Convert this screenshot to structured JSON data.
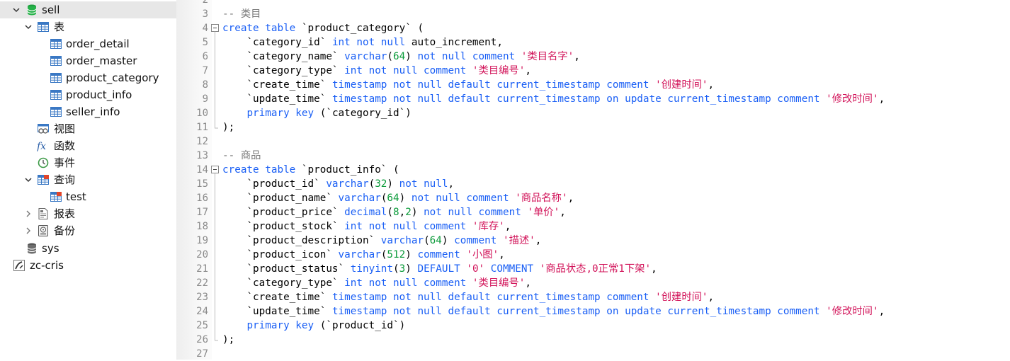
{
  "sidebar": {
    "db_sell": "sell",
    "tables_folder": "表",
    "tables": [
      "order_detail",
      "order_master",
      "product_category",
      "product_info",
      "seller_info"
    ],
    "views": "视图",
    "functions": "函数",
    "events": "事件",
    "queries": "查询",
    "query_items": [
      "test"
    ],
    "reports": "报表",
    "backups": "备份",
    "db_sys": "sys",
    "connection": "zc-cris"
  },
  "editor": {
    "lines": [
      {
        "n": "2",
        "tokens": []
      },
      {
        "n": "3",
        "tokens": [
          {
            "c": "cm",
            "t": "-- 类目"
          }
        ]
      },
      {
        "n": "4",
        "fold": "open",
        "tokens": [
          {
            "c": "kw",
            "t": "create table "
          },
          {
            "c": "",
            "t": "`product_category` ("
          }
        ]
      },
      {
        "n": "5",
        "tokens": [
          {
            "c": "",
            "t": "    `category_id` "
          },
          {
            "c": "kw",
            "t": "int not null "
          },
          {
            "c": "",
            "t": "auto_increment,"
          }
        ]
      },
      {
        "n": "6",
        "tokens": [
          {
            "c": "",
            "t": "    `category_name` "
          },
          {
            "c": "kw",
            "t": "varchar"
          },
          {
            "c": "",
            "t": "("
          },
          {
            "c": "num",
            "t": "64"
          },
          {
            "c": "",
            "t": ") "
          },
          {
            "c": "kw",
            "t": "not null comment "
          },
          {
            "c": "str",
            "t": "'类目名字'"
          },
          {
            "c": "",
            "t": ","
          }
        ]
      },
      {
        "n": "7",
        "tokens": [
          {
            "c": "",
            "t": "    `category_type` "
          },
          {
            "c": "kw",
            "t": "int not null comment "
          },
          {
            "c": "str",
            "t": "'类目编号'"
          },
          {
            "c": "",
            "t": ","
          }
        ]
      },
      {
        "n": "8",
        "tokens": [
          {
            "c": "",
            "t": "    `create_time` "
          },
          {
            "c": "kw",
            "t": "timestamp not null default current_timestamp comment "
          },
          {
            "c": "str",
            "t": "'创建时间'"
          },
          {
            "c": "",
            "t": ","
          }
        ]
      },
      {
        "n": "9",
        "tokens": [
          {
            "c": "",
            "t": "    `update_time` "
          },
          {
            "c": "kw",
            "t": "timestamp not null default current_timestamp on update current_timestamp comment "
          },
          {
            "c": "str",
            "t": "'修改时间'"
          },
          {
            "c": "",
            "t": ","
          }
        ]
      },
      {
        "n": "10",
        "tokens": [
          {
            "c": "",
            "t": "    "
          },
          {
            "c": "kw",
            "t": "primary key "
          },
          {
            "c": "",
            "t": "(`category_id`)"
          }
        ]
      },
      {
        "n": "11",
        "fold": "end",
        "tokens": [
          {
            "c": "",
            "t": ");"
          }
        ]
      },
      {
        "n": "12",
        "tokens": []
      },
      {
        "n": "13",
        "tokens": [
          {
            "c": "cm",
            "t": "-- 商品"
          }
        ]
      },
      {
        "n": "14",
        "fold": "open",
        "tokens": [
          {
            "c": "kw",
            "t": "create table "
          },
          {
            "c": "",
            "t": "`product_info` ("
          }
        ]
      },
      {
        "n": "15",
        "tokens": [
          {
            "c": "",
            "t": "    `product_id` "
          },
          {
            "c": "kw",
            "t": "varchar"
          },
          {
            "c": "",
            "t": "("
          },
          {
            "c": "num",
            "t": "32"
          },
          {
            "c": "",
            "t": ") "
          },
          {
            "c": "kw",
            "t": "not null"
          },
          {
            "c": "",
            "t": ","
          }
        ]
      },
      {
        "n": "16",
        "tokens": [
          {
            "c": "",
            "t": "    `product_name` "
          },
          {
            "c": "kw",
            "t": "varchar"
          },
          {
            "c": "",
            "t": "("
          },
          {
            "c": "num",
            "t": "64"
          },
          {
            "c": "",
            "t": ") "
          },
          {
            "c": "kw",
            "t": "not null comment "
          },
          {
            "c": "str",
            "t": "'商品名称'"
          },
          {
            "c": "",
            "t": ","
          }
        ]
      },
      {
        "n": "17",
        "tokens": [
          {
            "c": "",
            "t": "    `product_price` "
          },
          {
            "c": "kw",
            "t": "decimal"
          },
          {
            "c": "",
            "t": "("
          },
          {
            "c": "num",
            "t": "8"
          },
          {
            "c": "",
            "t": ","
          },
          {
            "c": "num",
            "t": "2"
          },
          {
            "c": "",
            "t": ") "
          },
          {
            "c": "kw",
            "t": "not null comment "
          },
          {
            "c": "str",
            "t": "'单价'"
          },
          {
            "c": "",
            "t": ","
          }
        ]
      },
      {
        "n": "18",
        "tokens": [
          {
            "c": "",
            "t": "    `product_stock` "
          },
          {
            "c": "kw",
            "t": "int not null comment "
          },
          {
            "c": "str",
            "t": "'库存'"
          },
          {
            "c": "",
            "t": ","
          }
        ]
      },
      {
        "n": "19",
        "tokens": [
          {
            "c": "",
            "t": "    `product_description` "
          },
          {
            "c": "kw",
            "t": "varchar"
          },
          {
            "c": "",
            "t": "("
          },
          {
            "c": "num",
            "t": "64"
          },
          {
            "c": "",
            "t": ") "
          },
          {
            "c": "kw",
            "t": "comment "
          },
          {
            "c": "str",
            "t": "'描述'"
          },
          {
            "c": "",
            "t": ","
          }
        ]
      },
      {
        "n": "20",
        "tokens": [
          {
            "c": "",
            "t": "    `product_icon` "
          },
          {
            "c": "kw",
            "t": "varchar"
          },
          {
            "c": "",
            "t": "("
          },
          {
            "c": "num",
            "t": "512"
          },
          {
            "c": "",
            "t": ") "
          },
          {
            "c": "kw",
            "t": "comment "
          },
          {
            "c": "str",
            "t": "'小图'"
          },
          {
            "c": "",
            "t": ","
          }
        ]
      },
      {
        "n": "21",
        "tokens": [
          {
            "c": "",
            "t": "    `product_status` "
          },
          {
            "c": "kw",
            "t": "tinyint"
          },
          {
            "c": "",
            "t": "("
          },
          {
            "c": "num",
            "t": "3"
          },
          {
            "c": "",
            "t": ") "
          },
          {
            "c": "kw",
            "t": "DEFAULT "
          },
          {
            "c": "str",
            "t": "'0'"
          },
          {
            "c": "",
            "t": " "
          },
          {
            "c": "kw",
            "t": "COMMENT "
          },
          {
            "c": "str",
            "t": "'商品状态,0正常1下架'"
          },
          {
            "c": "",
            "t": ","
          }
        ]
      },
      {
        "n": "22",
        "tokens": [
          {
            "c": "",
            "t": "    `category_type` "
          },
          {
            "c": "kw",
            "t": "int not null comment "
          },
          {
            "c": "str",
            "t": "'类目编号'"
          },
          {
            "c": "",
            "t": ","
          }
        ]
      },
      {
        "n": "23",
        "tokens": [
          {
            "c": "",
            "t": "    `create_time` "
          },
          {
            "c": "kw",
            "t": "timestamp not null default current_timestamp comment "
          },
          {
            "c": "str",
            "t": "'创建时间'"
          },
          {
            "c": "",
            "t": ","
          }
        ]
      },
      {
        "n": "24",
        "tokens": [
          {
            "c": "",
            "t": "    `update_time` "
          },
          {
            "c": "kw",
            "t": "timestamp not null default current_timestamp on update current_timestamp comment "
          },
          {
            "c": "str",
            "t": "'修改时间'"
          },
          {
            "c": "",
            "t": ","
          }
        ]
      },
      {
        "n": "25",
        "tokens": [
          {
            "c": "",
            "t": "    "
          },
          {
            "c": "kw",
            "t": "primary key "
          },
          {
            "c": "",
            "t": "(`product_id`)"
          }
        ]
      },
      {
        "n": "26",
        "fold": "end",
        "tokens": [
          {
            "c": "",
            "t": ");"
          }
        ]
      },
      {
        "n": "27",
        "tokens": []
      }
    ]
  },
  "colors": {
    "keyword": "#1a5ff5",
    "number": "#0b9b3a",
    "string": "#d2145a",
    "comment": "#777777",
    "selection": "#e7e7e7"
  }
}
